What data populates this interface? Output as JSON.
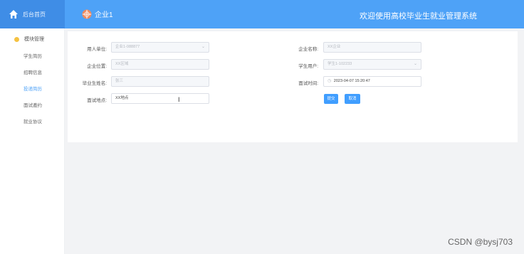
{
  "header": {
    "home_label": "后台首页",
    "enterprise_label": "企业1",
    "system_title": "欢迎使用高校毕业生就业管理系统"
  },
  "sidebar": {
    "header": "模块管理",
    "items": [
      {
        "label": "学生简历"
      },
      {
        "label": "招聘信息"
      },
      {
        "label": "投递简历"
      },
      {
        "label": "面试邀约"
      },
      {
        "label": "就业协议"
      }
    ]
  },
  "form": {
    "employer_unit_label": "用人单位:",
    "employer_unit_value": "企业1-088877",
    "enterprise_name_label": "企业名称:",
    "enterprise_name_value": "XX企业",
    "enterprise_location_label": "企业位置:",
    "enterprise_location_value": "XX区域",
    "student_user_label": "学生用户:",
    "student_user_value": "学生1-102233",
    "graduate_name_label": "毕业生姓名:",
    "graduate_name_value": "张三",
    "interview_time_label": "面试时间:",
    "interview_time_value": "2023-04-07 15:20:47",
    "interview_place_label": "面试地点:",
    "interview_place_value": "XX地点",
    "submit_label": "提交",
    "cancel_label": "取消"
  },
  "watermark": "CSDN @bysj703",
  "colors": {
    "header_bg": "#4ea2f7",
    "home_bg": "#3f8de6",
    "button": "#409eff",
    "active_menu": "#4ea2f7"
  }
}
